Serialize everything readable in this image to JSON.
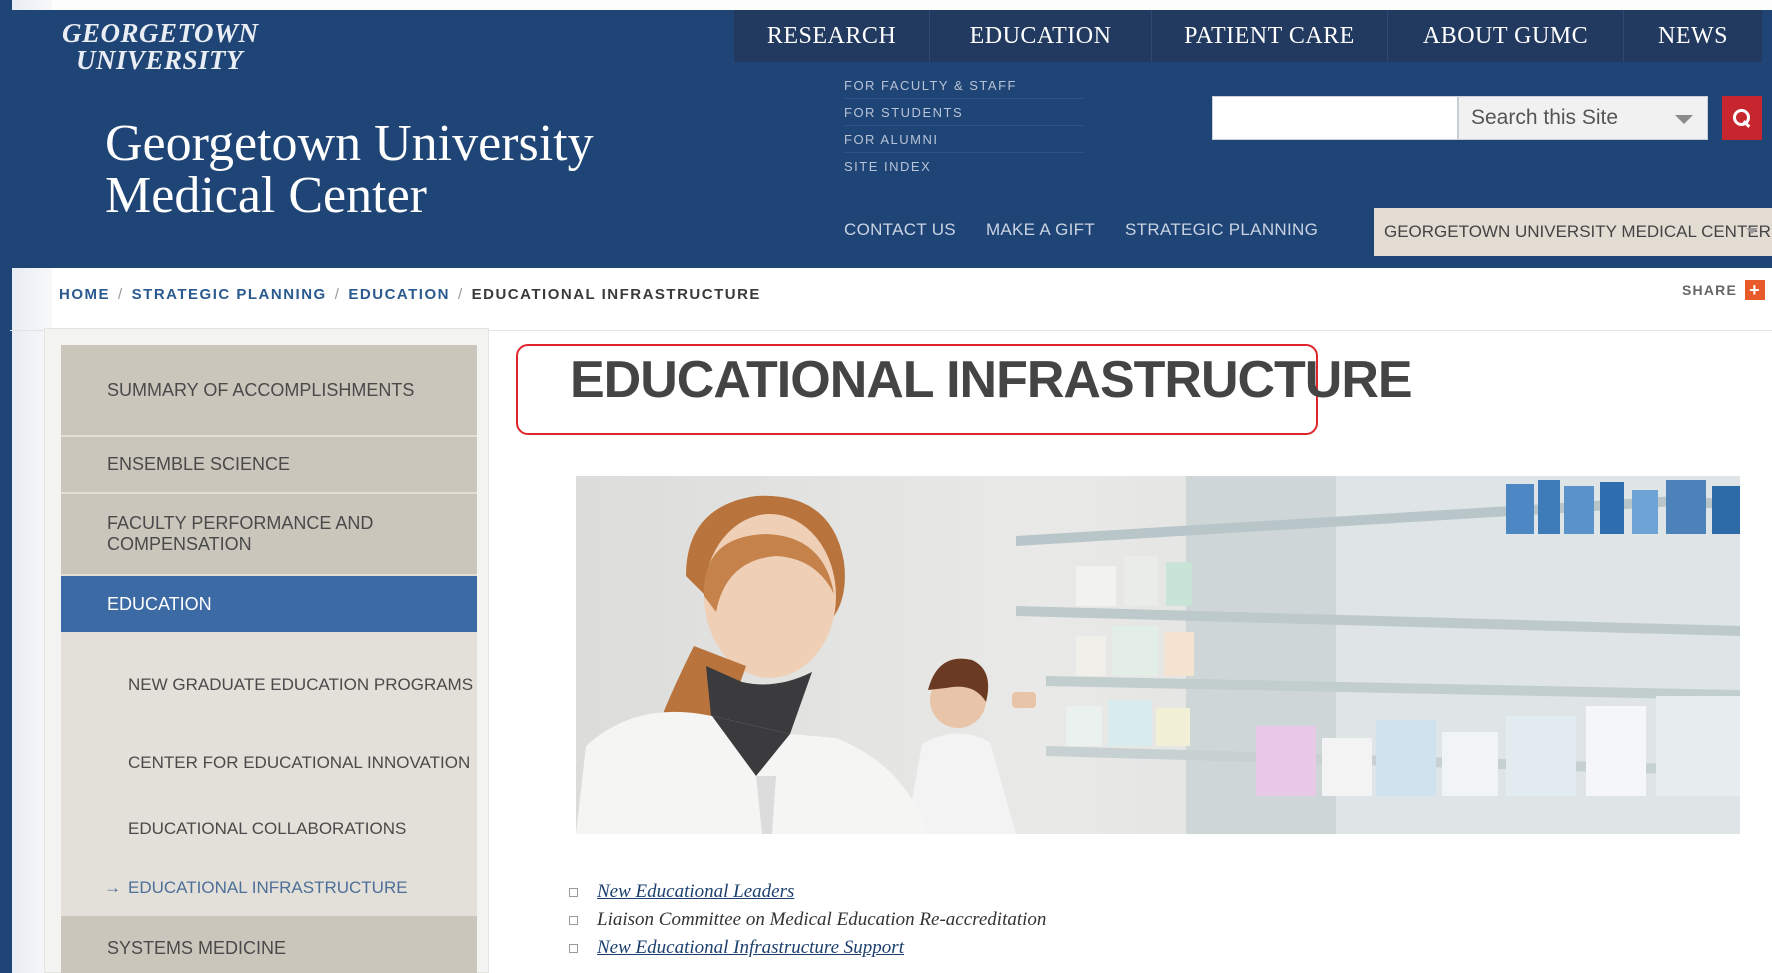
{
  "header": {
    "logo_line1": "GEORGETOWN",
    "logo_line2": "UNIVERSITY",
    "site_title_line1": "Georgetown University",
    "site_title_line2": "Medical Center",
    "topnav": [
      "RESEARCH",
      "EDUCATION",
      "PATIENT CARE",
      "ABOUT GUMC",
      "NEWS"
    ],
    "utility_links": [
      "FOR FACULTY & STAFF",
      "FOR STUDENTS",
      "FOR ALUMNI",
      "SITE INDEX"
    ],
    "search": {
      "value": "",
      "scope_label": "Search this Site"
    },
    "quick_links": [
      "CONTACT US",
      "MAKE A GIFT",
      "STRATEGIC PLANNING"
    ],
    "site_selector": "GEORGETOWN UNIVERSITY MEDICAL CENTER"
  },
  "breadcrumb": {
    "items": [
      "HOME",
      "STRATEGIC PLANNING",
      "EDUCATION"
    ],
    "current": "EDUCATIONAL INFRASTRUCTURE",
    "separator": "/"
  },
  "share_label": "SHARE",
  "sidebar": {
    "items": [
      {
        "label": "SUMMARY OF ACCOMPLISHMENTS"
      },
      {
        "label": "ENSEMBLE SCIENCE"
      },
      {
        "label": "FACULTY PERFORMANCE AND COMPENSATION"
      },
      {
        "label": "EDUCATION",
        "active": true
      },
      {
        "label": "NEW GRADUATE EDUCATION PROGRAMS",
        "sub": true
      },
      {
        "label": "CENTER FOR EDUCATIONAL INNOVATION",
        "sub": true
      },
      {
        "label": "EDUCATIONAL COLLABORATIONS",
        "sub": true
      },
      {
        "label": "EDUCATIONAL INFRASTRUCTURE",
        "sub": true,
        "current": true,
        "marker": "→"
      },
      {
        "label": "SYSTEMS MEDICINE"
      }
    ]
  },
  "main": {
    "title": "EDUCATIONAL INFRASTRUCTURE",
    "links": [
      {
        "label": "New Educational Leaders",
        "linked": true
      },
      {
        "label": "Liaison Committee on Medical Education Re-accreditation",
        "linked": false
      },
      {
        "label": "New Educational Infrastructure Support",
        "linked": true
      }
    ]
  },
  "colors": {
    "header_blue": "#1f4476",
    "active_nav": "#3b6aa5",
    "highlight_border": "#e0242b",
    "search_button": "#c8262e"
  }
}
